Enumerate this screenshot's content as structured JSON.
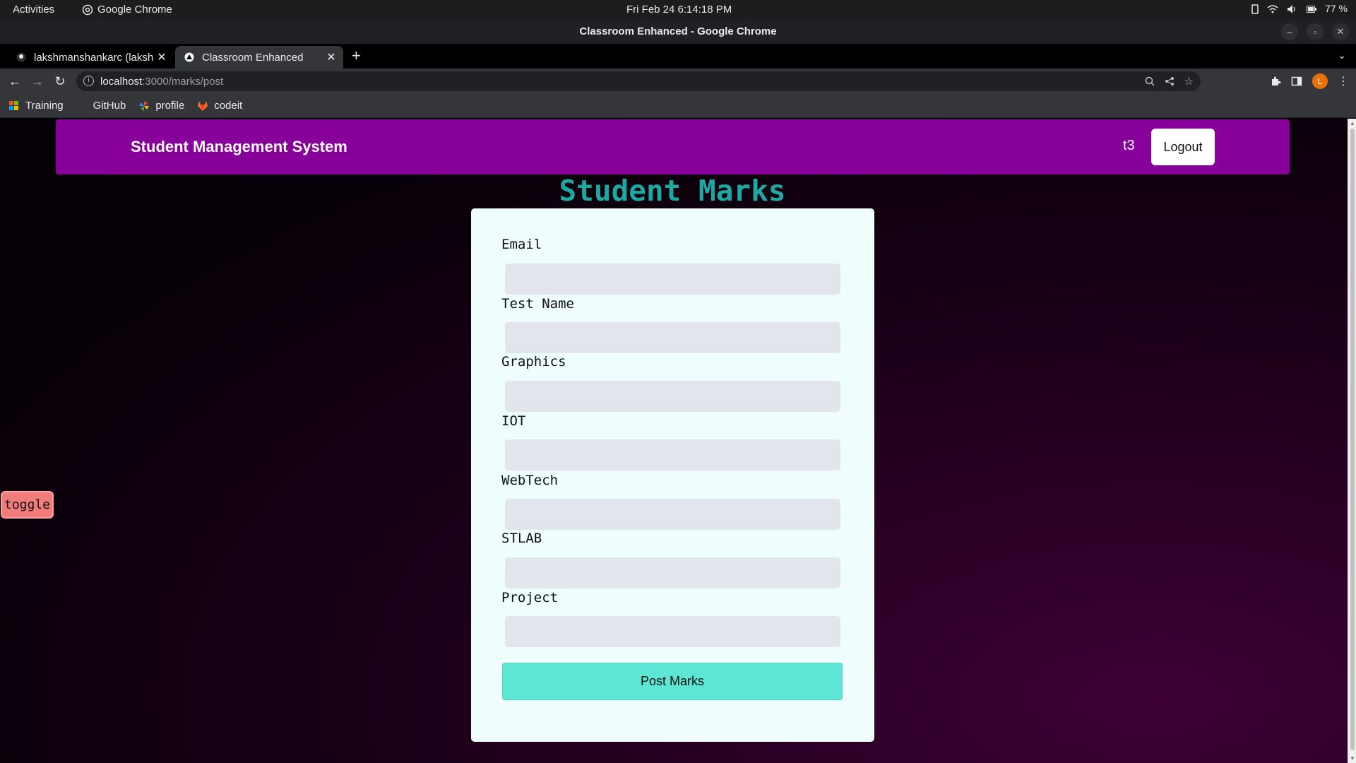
{
  "system_bar": {
    "activities": "Activities",
    "app_name": "Google Chrome",
    "clock": "Fri Feb 24   6:14:18 PM",
    "battery": "77 %"
  },
  "window": {
    "title": "Classroom Enhanced - Google Chrome"
  },
  "tabs": [
    {
      "label": "lakshmanshankarc (laksh",
      "active": false
    },
    {
      "label": "Classroom Enhanced",
      "active": true
    }
  ],
  "address_bar": {
    "host": "localhost",
    "path": ":3000/marks/post"
  },
  "profile_initial": "L",
  "bookmarks": [
    {
      "label": "Training"
    },
    {
      "label": "GitHub"
    },
    {
      "label": "profile"
    },
    {
      "label": "codeit"
    }
  ],
  "page": {
    "brand": "Student Management System",
    "username": "t3",
    "logout_label": "Logout",
    "heading": "Student Marks",
    "fields": [
      {
        "label": "Email",
        "value": ""
      },
      {
        "label": "Test Name",
        "value": ""
      },
      {
        "label": "Graphics",
        "value": ""
      },
      {
        "label": "IOT",
        "value": ""
      },
      {
        "label": "WebTech",
        "value": ""
      },
      {
        "label": "STLAB",
        "value": ""
      },
      {
        "label": "Project",
        "value": ""
      }
    ],
    "submit_label": "Post Marks",
    "toggle_label": "toggle"
  },
  "colors": {
    "navbar": "#87009a",
    "heading": "#1fa7a1",
    "submit": "#5ee6d5",
    "toggle": "#f27c7c",
    "card": "#effdfd"
  }
}
